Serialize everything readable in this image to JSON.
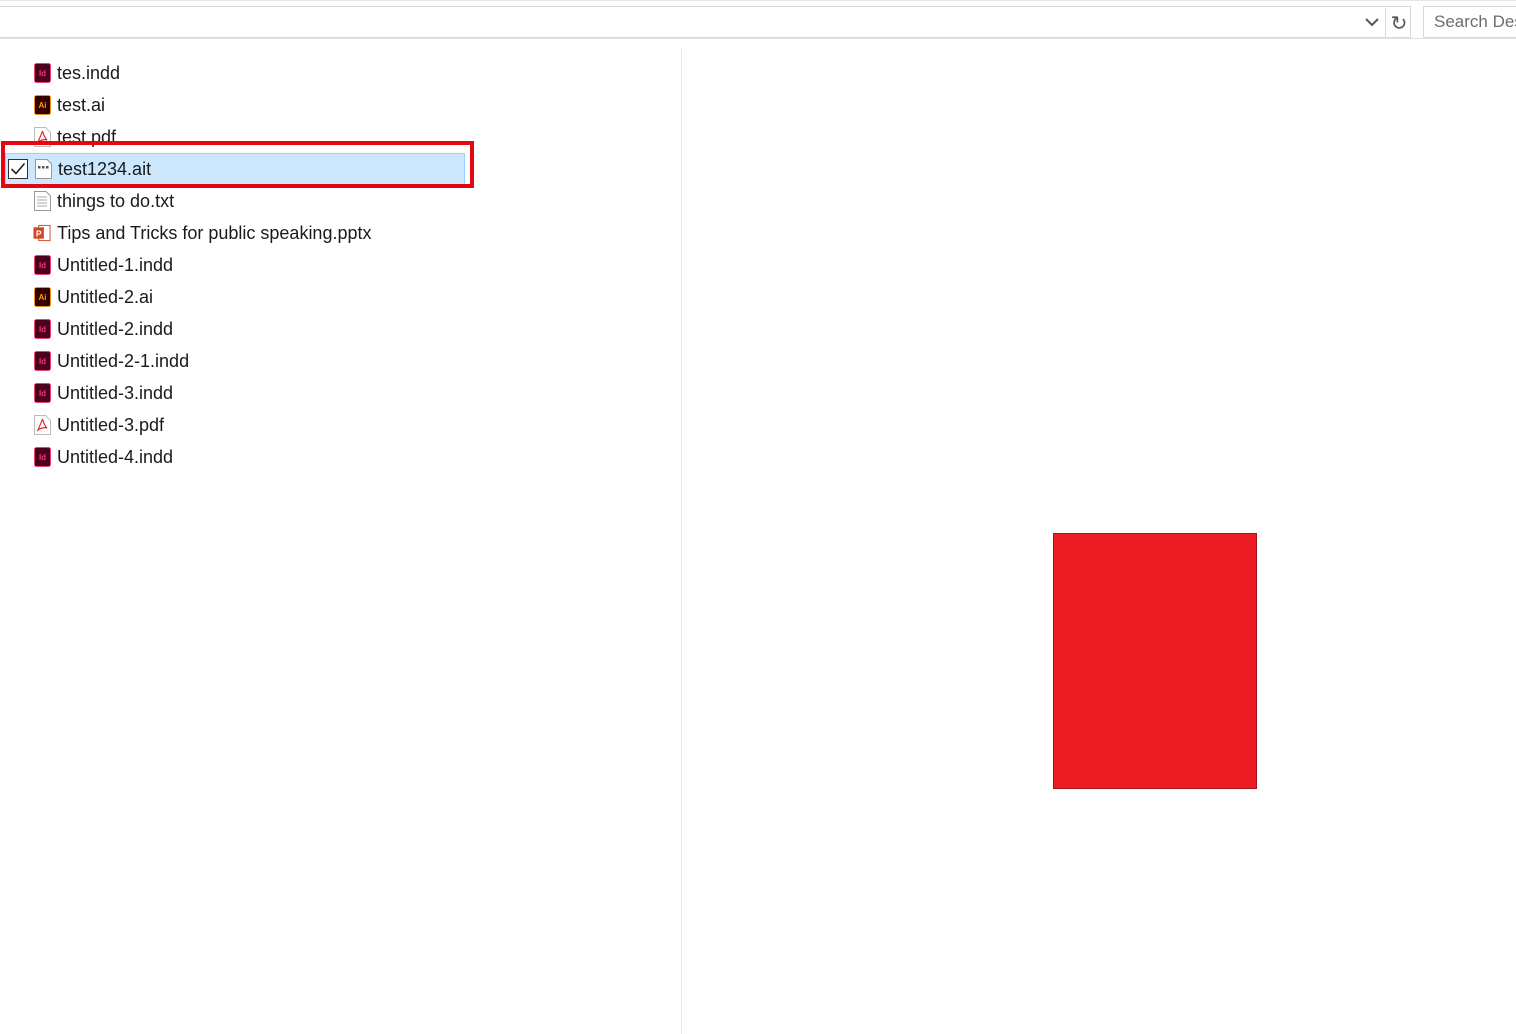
{
  "toolbar": {
    "dropdown_icon": "chevron-down-icon",
    "refresh_icon": "refresh-icon",
    "refresh_glyph": "↻",
    "search_placeholder": "Search Des"
  },
  "files": [
    {
      "name": "tes.indd",
      "icon": "indesign-icon",
      "icon_label": "Id",
      "icon_color": "#49021f",
      "icon_text_color": "#ff3366"
    },
    {
      "name": "test.ai",
      "icon": "illustrator-icon",
      "icon_label": "Ai",
      "icon_color": "#330000",
      "icon_text_color": "#ff9a00"
    },
    {
      "name": "test.pdf",
      "icon": "pdf-icon"
    },
    {
      "name": "test1234.ait",
      "icon": "generic-file-icon",
      "selected": true,
      "checked": true
    },
    {
      "name": "things to do.txt",
      "icon": "text-file-icon"
    },
    {
      "name": "Tips and Tricks for public speaking.pptx",
      "icon": "powerpoint-icon",
      "icon_label": "P",
      "icon_color": "#d24726"
    },
    {
      "name": "Untitled-1.indd",
      "icon": "indesign-icon",
      "icon_label": "Id",
      "icon_color": "#49021f",
      "icon_text_color": "#ff3366"
    },
    {
      "name": "Untitled-2.ai",
      "icon": "illustrator-icon",
      "icon_label": "Ai",
      "icon_color": "#330000",
      "icon_text_color": "#ff9a00"
    },
    {
      "name": "Untitled-2.indd",
      "icon": "indesign-icon",
      "icon_label": "Id",
      "icon_color": "#49021f",
      "icon_text_color": "#ff3366"
    },
    {
      "name": "Untitled-2-1.indd",
      "icon": "indesign-icon",
      "icon_label": "Id",
      "icon_color": "#49021f",
      "icon_text_color": "#ff3366"
    },
    {
      "name": "Untitled-3.indd",
      "icon": "indesign-icon",
      "icon_label": "Id",
      "icon_color": "#49021f",
      "icon_text_color": "#ff3366"
    },
    {
      "name": "Untitled-3.pdf",
      "icon": "pdf-icon"
    },
    {
      "name": "Untitled-4.indd",
      "icon": "indesign-icon",
      "icon_label": "Id",
      "icon_color": "#49021f",
      "icon_text_color": "#ff3366"
    }
  ],
  "preview": {
    "shape_color": "#ed1c24"
  },
  "colors": {
    "selection_bg": "#cce8ff",
    "selection_border": "#99d1ff",
    "highlight_border": "#e30613",
    "pdf_red": "#e4262b"
  }
}
